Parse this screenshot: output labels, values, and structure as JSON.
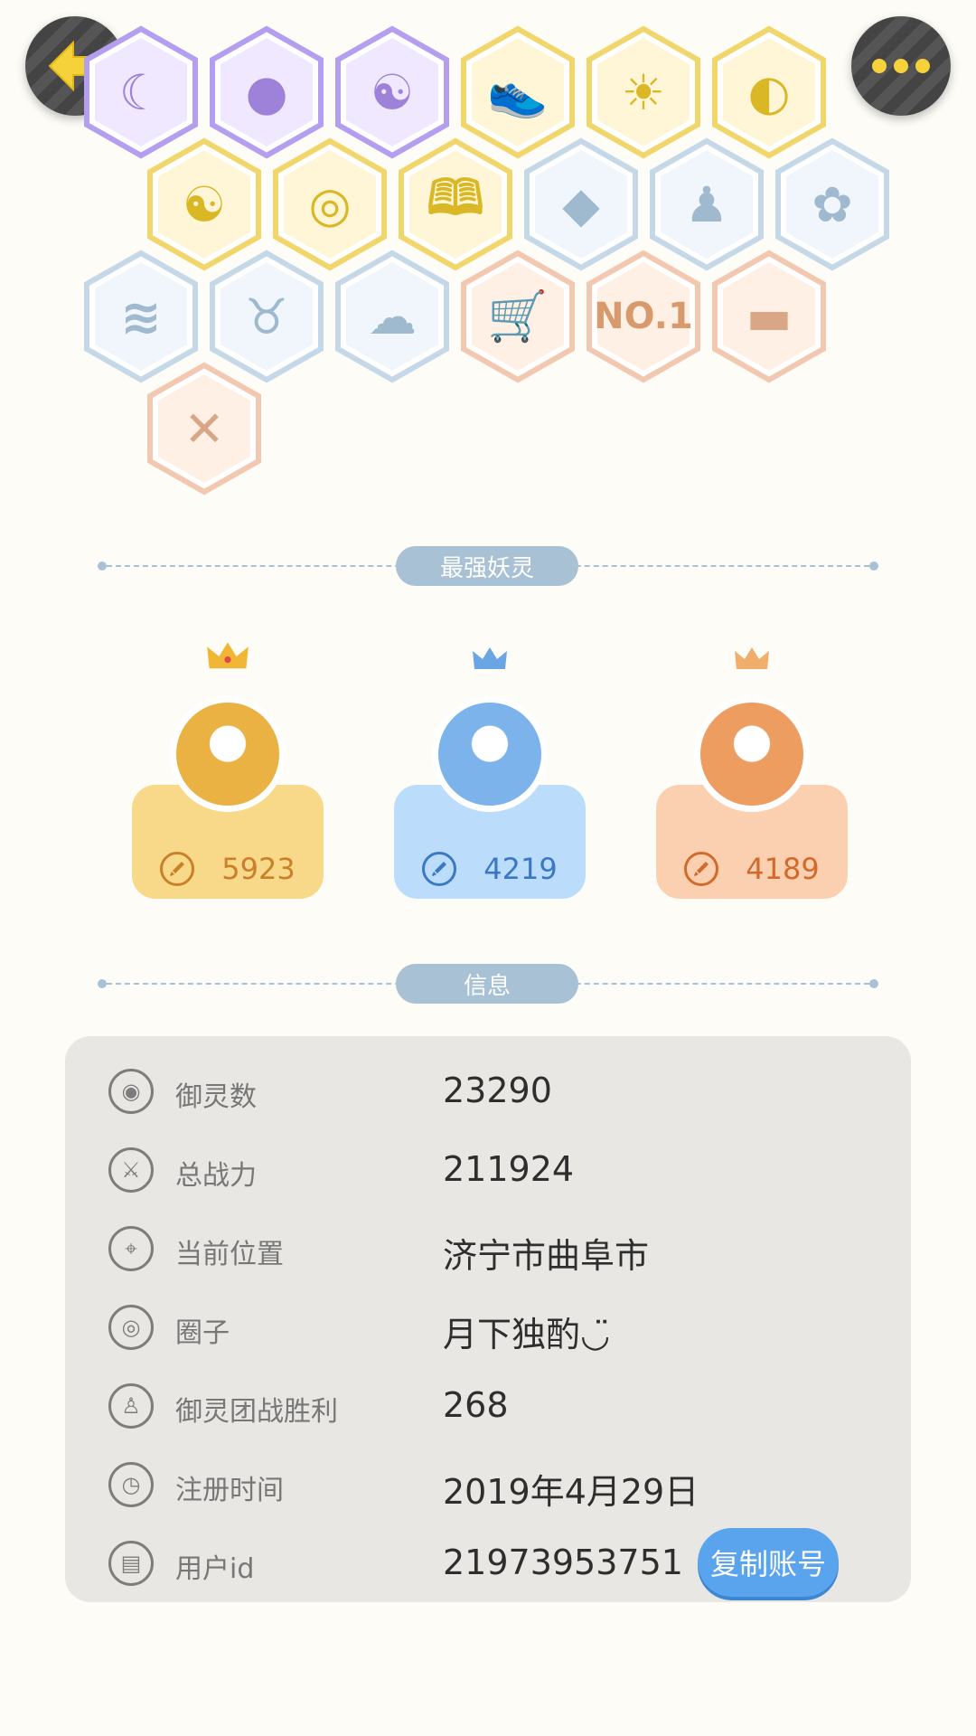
{
  "header": {
    "back_icon": "back-arrow-icon",
    "more_icon": "more-dots-icon"
  },
  "badges": {
    "row1": [
      {
        "icon": "moon-spirit-icon",
        "color": "#b39ef0",
        "fill": "#efe8ff"
      },
      {
        "icon": "purple-orb-icon",
        "color": "#b39ef0",
        "fill": "#efe8ff"
      },
      {
        "icon": "yin-yang-swirl-icon",
        "color": "#b39ef0",
        "fill": "#efe8ff"
      },
      {
        "icon": "sneaker-icon",
        "color": "#f1d66b",
        "fill": "#fff6d8"
      },
      {
        "icon": "sun-medal-icon",
        "color": "#f1d66b",
        "fill": "#fff6d8"
      },
      {
        "icon": "moon-sun-icon",
        "color": "#f1d66b",
        "fill": "#fff6d8"
      }
    ],
    "row2": [
      {
        "icon": "yin-yang-card-icon",
        "color": "#f1d66b",
        "fill": "#fff6d8"
      },
      {
        "icon": "shield-crest-icon",
        "color": "#f1d66b",
        "fill": "#fff6d8"
      },
      {
        "icon": "fox-book-icon",
        "color": "#f1d66b",
        "fill": "#fff6d8"
      },
      {
        "icon": "crystal-icon",
        "color": "#c5d8e8",
        "fill": "#f0f6fb"
      },
      {
        "icon": "spirit-figure-icon",
        "color": "#c5d8e8",
        "fill": "#f0f6fb"
      },
      {
        "icon": "cat-balloon-icon",
        "color": "#c5d8e8",
        "fill": "#f0f6fb"
      }
    ],
    "row3": [
      {
        "icon": "dragon-icon",
        "color": "#c5d8e8",
        "fill": "#f0f6fb"
      },
      {
        "icon": "horned-beast-icon",
        "color": "#c5d8e8",
        "fill": "#f0f6fb"
      },
      {
        "icon": "ghost-cat-icon",
        "color": "#c5d8e8",
        "fill": "#f0f6fb"
      },
      {
        "icon": "cat-cart-icon",
        "color": "#f3c8b0",
        "fill": "#fff0e6"
      },
      {
        "icon": "no1-icon",
        "color": "#f3c8b0",
        "fill": "#fff0e6",
        "text": "NO.1"
      },
      {
        "icon": "champion-belt-icon",
        "color": "#f3c8b0",
        "fill": "#fff0e6"
      }
    ],
    "row4": [
      {
        "icon": "crossed-swords-icon",
        "color": "#f3c8b0",
        "fill": "#fff0e6"
      }
    ]
  },
  "sections": {
    "strongest_title": "最强妖灵",
    "info_title": "信息"
  },
  "spirits": [
    {
      "rank": 1,
      "score": "5923",
      "card_color": "#f8d889",
      "score_color": "#c8812a",
      "ring_color": "#e9b243",
      "crown_color": "#f2b636"
    },
    {
      "rank": 2,
      "score": "4219",
      "card_color": "#bcdcfb",
      "score_color": "#3b78c4",
      "ring_color": "#7bb3ea",
      "crown_color": "#6aa6e4"
    },
    {
      "rank": 3,
      "score": "4189",
      "card_color": "#fad0b0",
      "score_color": "#d3692b",
      "ring_color": "#ee9d61",
      "crown_color": "#f0ae6c"
    }
  ],
  "info": {
    "rows": [
      {
        "icon": "spirit-count-icon",
        "label": "御灵数",
        "value": "23290"
      },
      {
        "icon": "sword-power-icon",
        "label": "总战力",
        "value": "211924"
      },
      {
        "icon": "location-pin-icon",
        "label": "当前位置",
        "value": "济宁市曲阜市"
      },
      {
        "icon": "circle-ring-icon",
        "label": "圈子",
        "value": "月下独酌◡̈"
      },
      {
        "icon": "team-battle-icon",
        "label": "御灵团战胜利",
        "value": "268"
      },
      {
        "icon": "clock-icon",
        "label": "注册时间",
        "value": "2019年4月29日"
      },
      {
        "icon": "user-id-icon",
        "label": "用户id",
        "value": "21973953751"
      }
    ],
    "copy_button": "复制账号"
  }
}
